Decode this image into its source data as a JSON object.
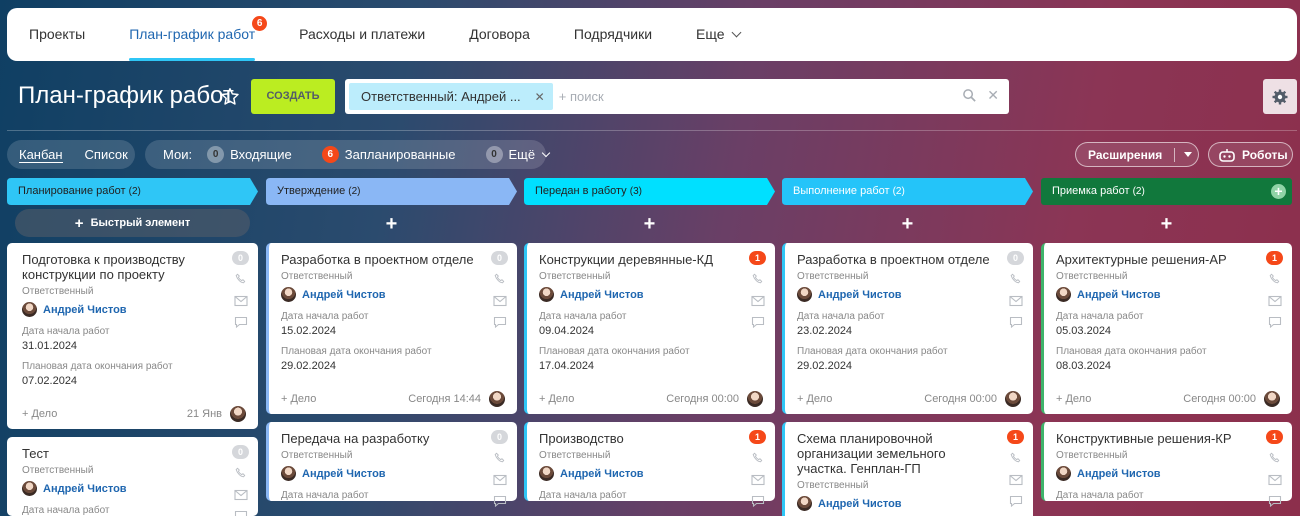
{
  "topnav": {
    "tabs": [
      {
        "label": "Проекты"
      },
      {
        "label": "План-график работ",
        "badge": "6"
      },
      {
        "label": "Расходы и платежи"
      },
      {
        "label": "Договора"
      },
      {
        "label": "Подрядчики"
      },
      {
        "label": "Еще"
      }
    ]
  },
  "header": {
    "title": "План-график работ",
    "create_label": "СОЗДАТЬ",
    "filter_chip": "Ответственный: Андрей ...",
    "search_placeholder": "+ поиск"
  },
  "toolbar": {
    "views": [
      "Канбан",
      "Список"
    ],
    "my_label": "Мои:",
    "counters": [
      {
        "count": "0",
        "label": "Входящие"
      },
      {
        "count": "6",
        "label": "Запланированные"
      },
      {
        "count": "0",
        "label": "Ещё"
      }
    ],
    "extensions_label": "Расширения",
    "robots_label": "Роботы"
  },
  "colors": {
    "accent": "#2fc6f6",
    "create": "#bbed21",
    "badge_red": "#f54819",
    "stage_planning": "#2fc6f6",
    "stage_approval": "#8ab7f5",
    "stage_transfer": "#00e0ff",
    "stage_execution": "#24c4f9",
    "stage_acceptance": "#11783c"
  },
  "board": {
    "quick_add": "Быстрый элемент",
    "labels": {
      "responsible": "Ответственный",
      "start": "Дата начала работ",
      "end": "Плановая дата окончания работ",
      "deal": "+ Дело"
    },
    "columns": [
      {
        "name": "Планирование работ",
        "count": "(2)",
        "cards": [
          {
            "title": "Подготовка к производству конструкции по проекту",
            "badge": "0",
            "user": "Андрей Чистов",
            "start": "31.01.2024",
            "end": "07.02.2024",
            "time": "21 Янв"
          },
          {
            "title": "Тест",
            "badge": "0",
            "user": "Андрей Чистов"
          }
        ]
      },
      {
        "name": "Утверждение",
        "count": "(2)",
        "cards": [
          {
            "title": "Разработка в проектном отделе",
            "badge": "0",
            "user": "Андрей Чистов",
            "start": "15.02.2024",
            "end": "29.02.2024",
            "time": "Сегодня 14:44"
          },
          {
            "title": "Передача на разработку",
            "badge": "0",
            "user": "Андрей Чистов"
          }
        ]
      },
      {
        "name": "Передан в работу",
        "count": "(3)",
        "cards": [
          {
            "title": "Конструкции деревянные-КД",
            "badge": "1",
            "user": "Андрей Чистов",
            "start": "09.04.2024",
            "end": "17.04.2024",
            "time": "Сегодня 00:00"
          },
          {
            "title": "Производство",
            "badge": "1",
            "user": "Андрей Чистов"
          }
        ]
      },
      {
        "name": "Выполнение работ",
        "count": "(2)",
        "cards": [
          {
            "title": "Разработка в проектном отделе",
            "badge": "0",
            "user": "Андрей Чистов",
            "start": "23.02.2024",
            "end": "29.02.2024",
            "time": "Сегодня 00:00"
          },
          {
            "title": "Схема планировочной организации земельного участка. Генплан-ГП",
            "badge": "1",
            "user": "Андрей Чистов"
          }
        ]
      },
      {
        "name": "Приемка работ",
        "count": "(2)",
        "cards": [
          {
            "title": "Архитектурные решения-АР",
            "badge": "1",
            "user": "Андрей Чистов",
            "start": "05.03.2024",
            "end": "08.03.2024",
            "time": "Сегодня 00:00"
          },
          {
            "title": "Конструктивные решения-КР",
            "badge": "1",
            "user": "Андрей Чистов"
          }
        ]
      }
    ]
  }
}
